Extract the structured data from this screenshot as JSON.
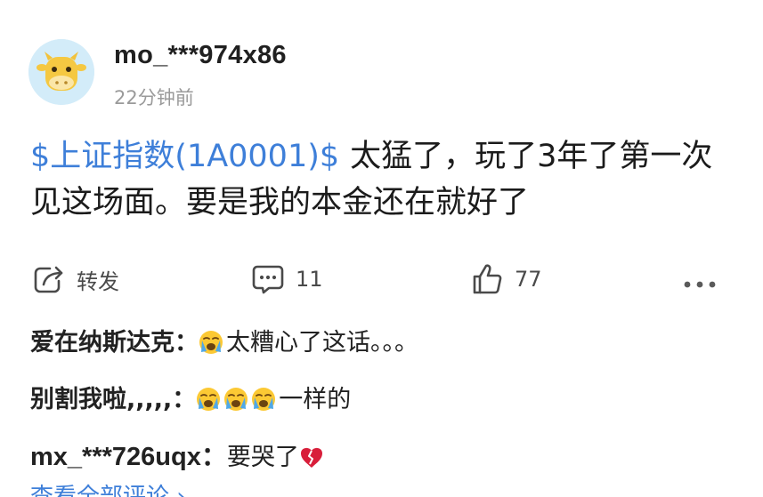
{
  "post": {
    "username": "mo_***974x86",
    "time": "22分钟前",
    "stock_tag": "$上证指数(1A0001)$",
    "text": "太猛了，玩了3年了第一次见这场面。要是我的本金还在就好了"
  },
  "actions": {
    "forward_label": "转发",
    "comment_count": "11",
    "like_count": "77"
  },
  "comments": [
    {
      "author": "爱在纳斯达克：",
      "text": "太糟心了这话。。。"
    },
    {
      "author": "别割我啦,,,,,：",
      "text": "一样的"
    },
    {
      "author": "mx_***726uqx：",
      "text": "要哭了"
    }
  ],
  "view_all": "查看全部评论 ›",
  "icons": {
    "avatar": "cartoon-cow-avatar",
    "forward": "share-icon",
    "comment": "comment-icon",
    "like": "thumbs-up-icon",
    "more": "more-dots-icon",
    "crying": "loudly-crying-face-emoji",
    "broken_heart": "broken-heart-emoji"
  },
  "colors": {
    "link": "#3e7fd9",
    "muted": "#9a9a9a",
    "avatar_bg": "#d3ecf9"
  }
}
